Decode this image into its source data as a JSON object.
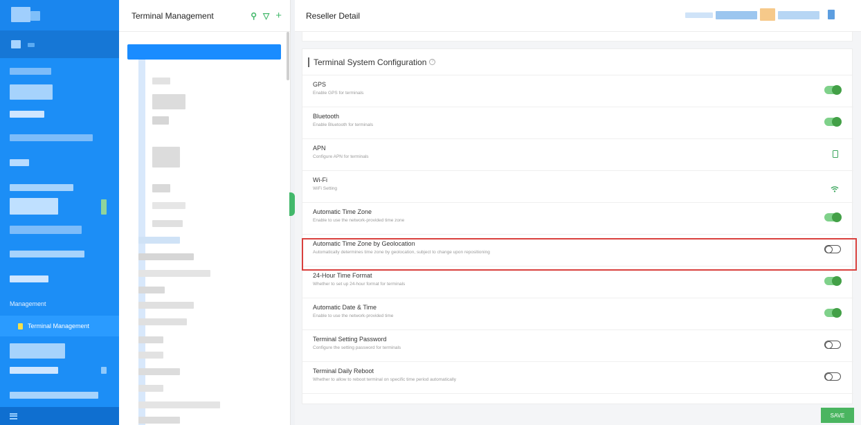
{
  "colors": {
    "sidebar": "#1c8ef6",
    "accent_green": "#43a047",
    "highlight_red": "#d9403d",
    "selected_blue": "#1a8cff"
  },
  "sidebar": {
    "section_label": "Management",
    "active_item": "Terminal Management",
    "active_icon": "document-icon",
    "bottom_icon": "menu-icon"
  },
  "list_pane": {
    "title": "Terminal Management",
    "icons": [
      "search-icon",
      "filter-icon",
      "add-icon"
    ],
    "search_glyph": "⚲",
    "filter_glyph": "▽",
    "add_glyph": "+"
  },
  "detail": {
    "title": "Reseller Detail",
    "section_title": "Terminal System Configuration",
    "help_glyph": "?",
    "save_label": "SAVE",
    "settings": [
      {
        "label": "GPS",
        "desc": "Enable GPS for terminals",
        "control": "toggle",
        "state": "on"
      },
      {
        "label": "Bluetooth",
        "desc": "Enable Bluetooth for terminals",
        "control": "toggle",
        "state": "on"
      },
      {
        "label": "APN",
        "desc": "Configure APN for terminals",
        "control": "icon",
        "icon": "sim-card-icon"
      },
      {
        "label": "Wi-Fi",
        "desc": "WiFi Setting",
        "control": "icon",
        "icon": "wifi-icon"
      },
      {
        "label": "Automatic Time Zone",
        "desc": "Enable to use the network-provided time zone",
        "control": "toggle",
        "state": "on"
      },
      {
        "label": "Automatic Time Zone by Geolocation",
        "desc": "Automatically determines time zone by geolocation, subject to change upon repositioning",
        "control": "toggle",
        "state": "off"
      },
      {
        "label": "24-Hour Time Format",
        "desc": "Whether to set up 24-hour format for terminals",
        "control": "toggle",
        "state": "on"
      },
      {
        "label": "Automatic Date & Time",
        "desc": "Enable to use the network-provided time",
        "control": "toggle",
        "state": "on"
      },
      {
        "label": "Terminal Setting Password",
        "desc": "Configure the setting password for terminals",
        "control": "toggle",
        "state": "off"
      },
      {
        "label": "Terminal Daily Reboot",
        "desc": "Whether to allow to reboot terminal on specific time period automatically",
        "control": "toggle",
        "state": "off"
      }
    ]
  }
}
